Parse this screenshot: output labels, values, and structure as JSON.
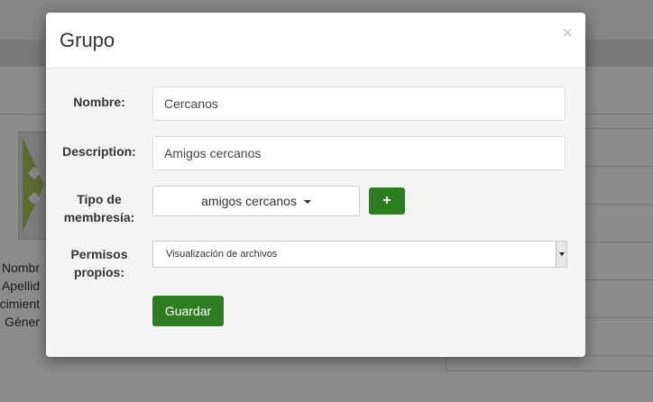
{
  "background": {
    "profile_labels": [
      "Nombr",
      "Apellid",
      "acimient",
      "Géner"
    ]
  },
  "modal": {
    "title": "Grupo",
    "close_symbol": "×",
    "form": {
      "name_label": "Nombre:",
      "name_value": "Cercanos",
      "description_label": "Description:",
      "description_value": "Amigos cercanos",
      "membership_label_line1": "Tipo de",
      "membership_label_line2": "membresía:",
      "membership_selected": "amigos cercanos",
      "add_membership_symbol": "+",
      "permissions_label_line1": "Permisos",
      "permissions_label_line2": "propios:",
      "permissions_selected": "Visualización de archivos",
      "save_label": "Guardar"
    }
  },
  "colors": {
    "primary_button": "#2f7d22",
    "backdrop": "rgba(0,0,0,0.45)"
  },
  "icons": {
    "close": "close-icon",
    "add": "plus-icon",
    "dropdown": "caret-down-icon"
  }
}
